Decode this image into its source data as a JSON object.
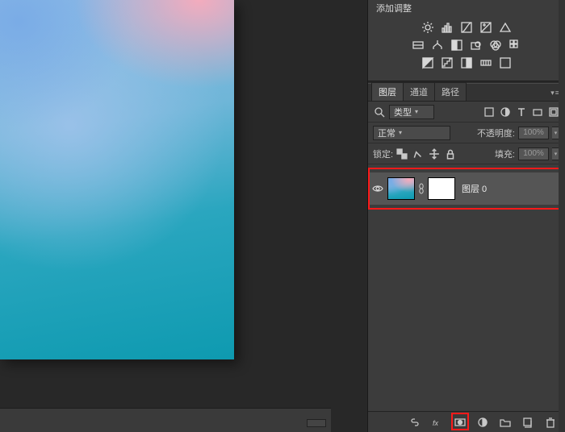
{
  "adjustments": {
    "title": "添加调整"
  },
  "tabs": {
    "layers": "图层",
    "channels": "通道",
    "paths": "路径"
  },
  "filter_row": {
    "kind": "类型"
  },
  "blend_row": {
    "mode": "正常",
    "opacity_label": "不透明度:",
    "opacity_value": "100%"
  },
  "lock_row": {
    "lock_label": "锁定:",
    "fill_label": "填充:",
    "fill_value": "100%"
  },
  "layers_list": [
    {
      "name": "图层 0"
    }
  ]
}
